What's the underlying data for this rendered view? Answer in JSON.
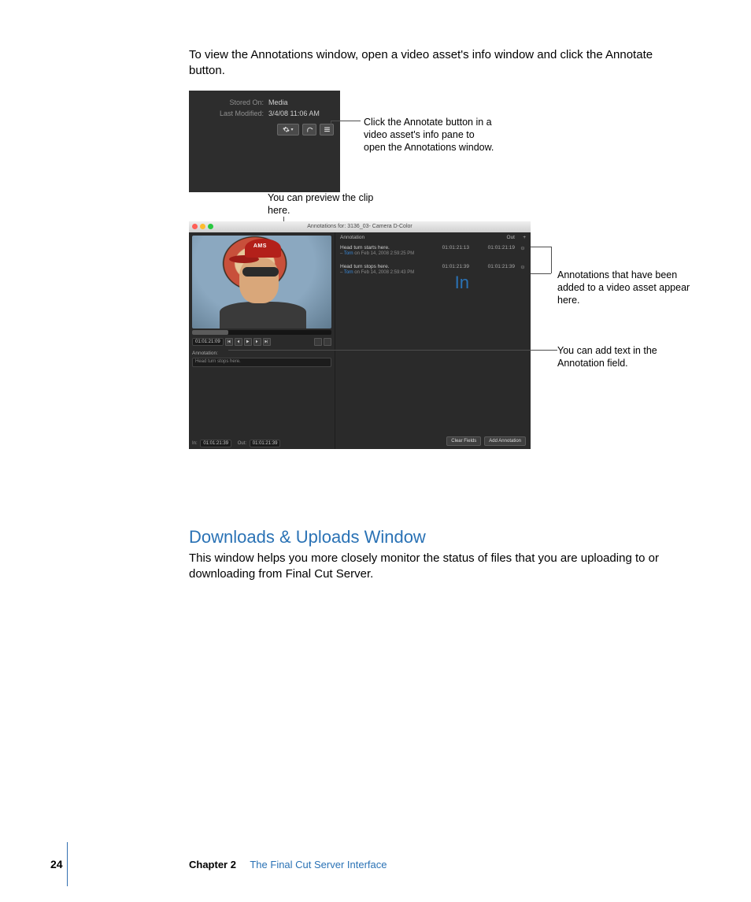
{
  "intro_paragraph": "To view the Annotations window, open a video asset's info window and click the Annotate button.",
  "fig1": {
    "stored_on_label": "Stored On:",
    "stored_on_value": "Media",
    "last_modified_label": "Last Modified:",
    "last_modified_value": "3/4/08 11:06 AM",
    "gear_icon": "gear",
    "refresh_icon": "refresh",
    "annotate_icon": "annotate",
    "callout": "Click the Annotate button in a video asset's info pane to open the Annotations window."
  },
  "fig2": {
    "preview_callout": "You can preview the clip here.",
    "list_callout": "Annotations that have been added to a video asset appear here.",
    "field_callout": "You can add text in the Annotation field.",
    "window_title": "Annotations for: 3136_03- Camera D-Color",
    "cap_text": "AMS",
    "timecode_current": "01:01:21:09",
    "annotation_section_label": "Annotation:",
    "annotation_field_value": "Head turn stops here.",
    "in_label": "In:",
    "in_value": "01:01:21:39",
    "out_label": "Out:",
    "out_value": "01:01:21:39",
    "clear_fields_btn": "Clear Fields",
    "add_annotation_btn": "Add Annotation",
    "list_headers": {
      "annotation": "Annotation",
      "in": "In",
      "out": "Out",
      "plus": "+"
    },
    "rows": [
      {
        "title": "Head turn starts here.",
        "by_prefix": "– ",
        "user": "Torn",
        "by_rest": " on Feb 14, 2008 2:59:25 PM",
        "in": "01:01:21:13",
        "out": "01:01:21:19"
      },
      {
        "title": "Head turn stops here.",
        "by_prefix": "– ",
        "user": "Torn",
        "by_rest": " on Feb 14, 2008 2:59:43 PM",
        "in": "01:01:21:39",
        "out": "01:01:21:39"
      }
    ]
  },
  "section_heading": "Downloads & Uploads Window",
  "section_body": "This window helps you more closely monitor the status of files that you are uploading to or downloading from Final Cut Server.",
  "footer": {
    "page_number": "24",
    "chapter_label": "Chapter 2",
    "chapter_title": "The Final Cut Server Interface"
  }
}
